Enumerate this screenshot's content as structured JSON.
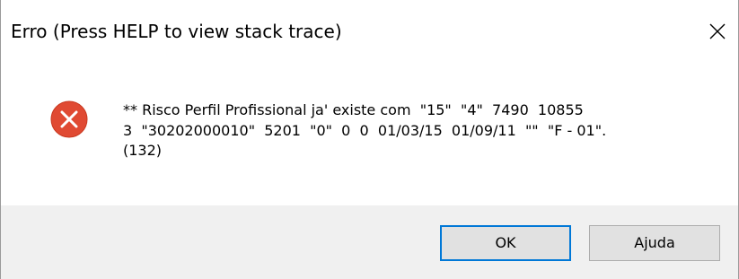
{
  "dialog": {
    "title": "Erro (Press HELP to view stack trace)",
    "close_icon": "close-icon",
    "error_icon": "error-icon",
    "message_lines": [
      "** Risco Perfil Profissional ja' existe com  \"15\"  \"4\"  7490  10855",
      "3  \"30202000010\"  5201  \"0\"  0  0  01/03/15  01/09/11  \"\"  \"F - 01\".",
      "(132)"
    ],
    "buttons": {
      "ok_label": "OK",
      "help_label": "Ajuda"
    }
  },
  "colors": {
    "error_red": "#e81123",
    "focus_blue": "#0078d7",
    "footer_bg": "#f0f0f0"
  }
}
